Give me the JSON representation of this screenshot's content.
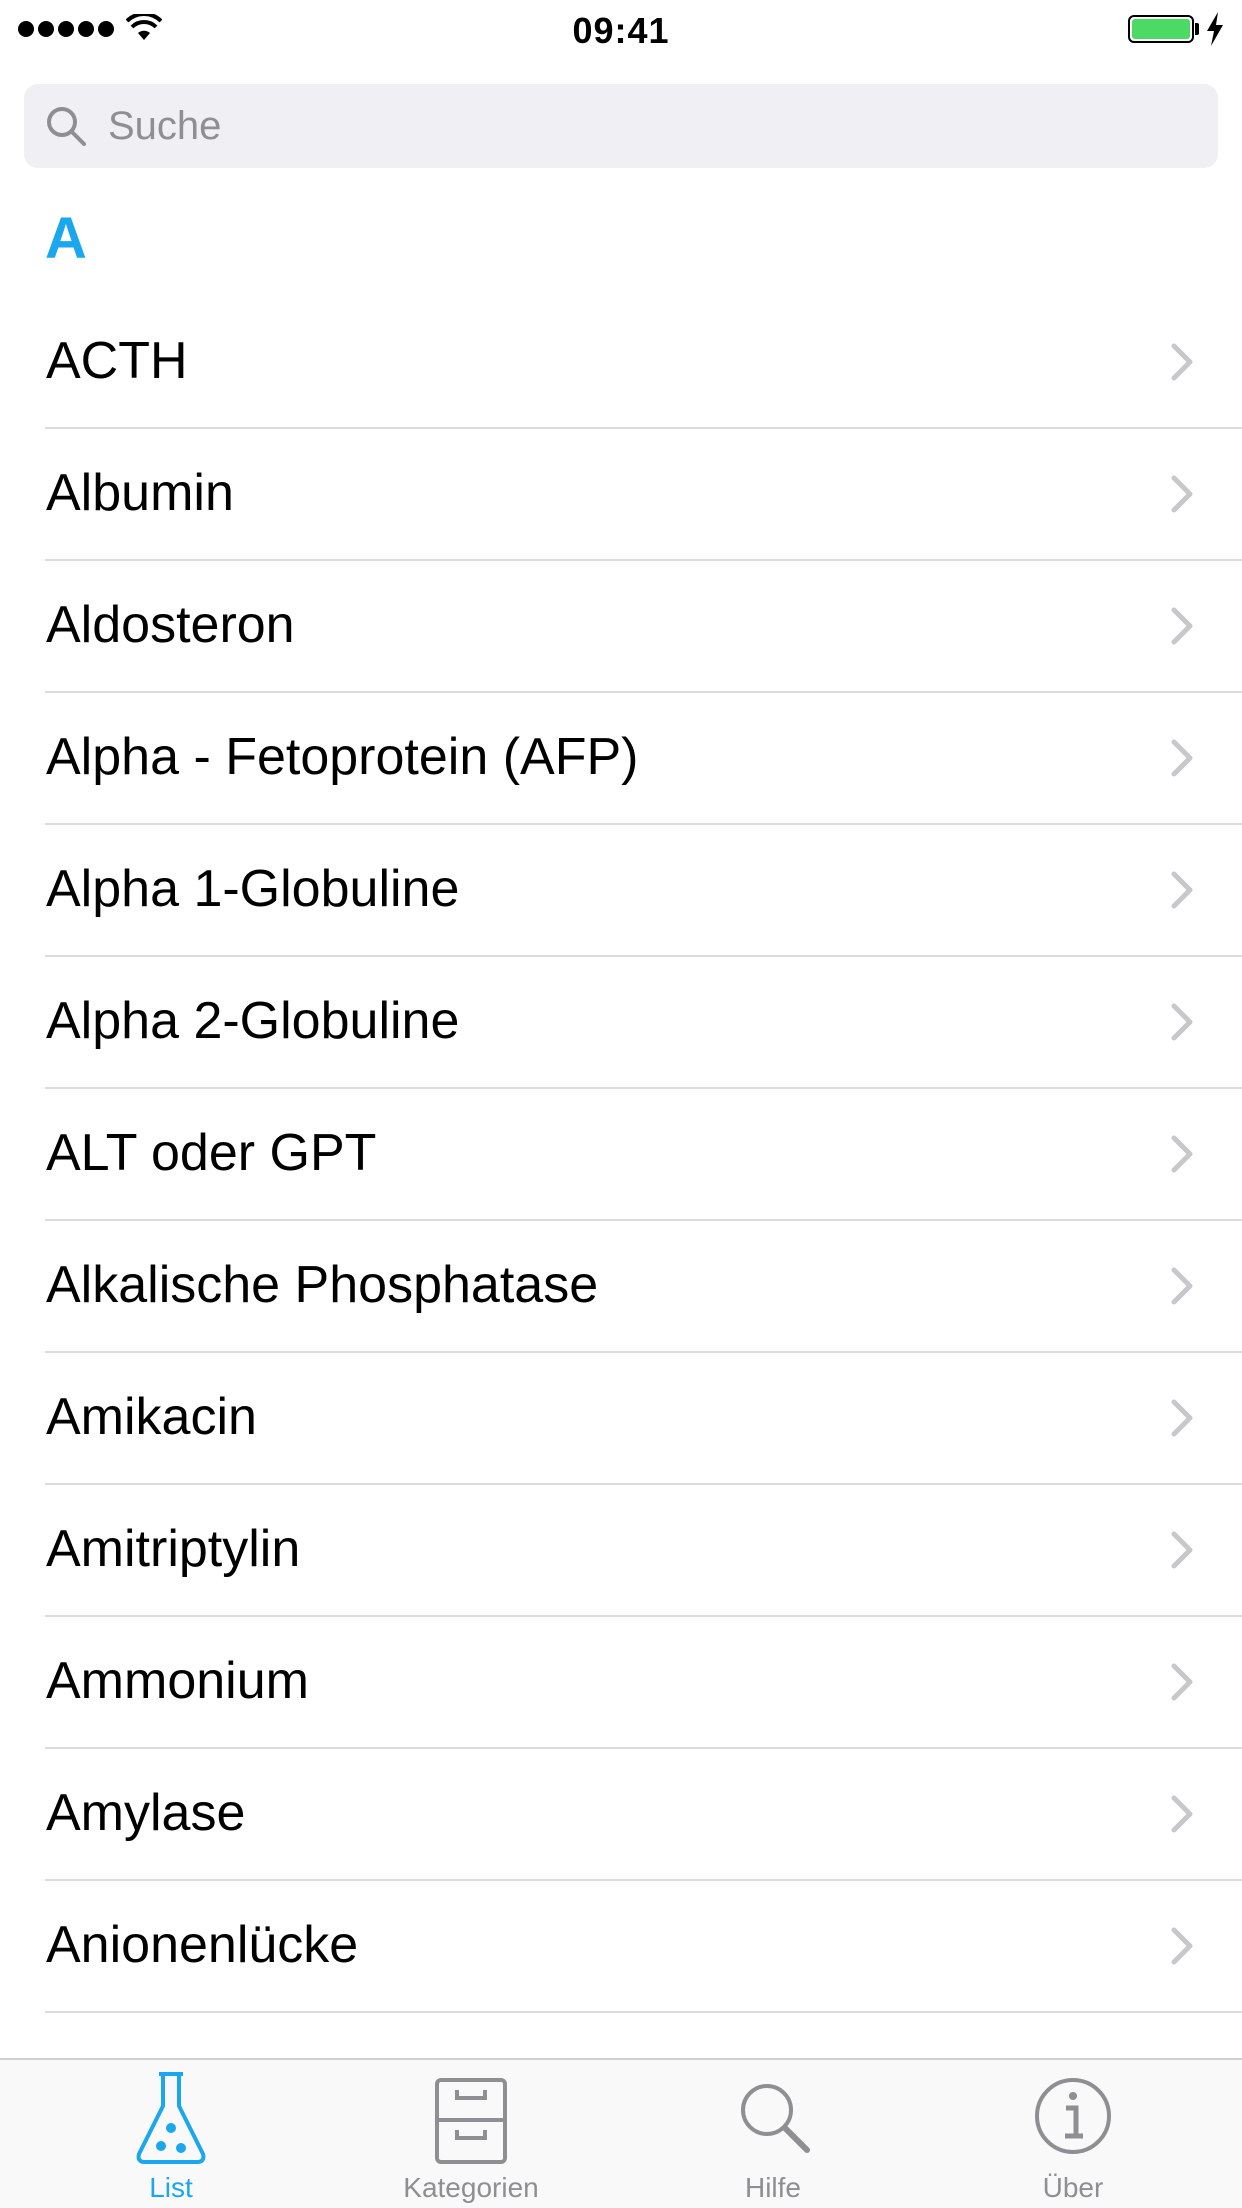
{
  "status_bar": {
    "time": "09:41",
    "battery_level": 1.0,
    "charging": true,
    "signal_bars": 5
  },
  "search": {
    "placeholder": "Suche",
    "value": ""
  },
  "section": {
    "header": "A"
  },
  "list": {
    "items": [
      {
        "label": "ACTH"
      },
      {
        "label": "Albumin"
      },
      {
        "label": "Aldosteron"
      },
      {
        "label": "Alpha - Fetoprotein (AFP)"
      },
      {
        "label": "Alpha 1-Globuline"
      },
      {
        "label": "Alpha 2-Globuline"
      },
      {
        "label": "ALT oder GPT"
      },
      {
        "label": "Alkalische Phosphatase"
      },
      {
        "label": "Amikacin"
      },
      {
        "label": "Amitriptylin"
      },
      {
        "label": "Ammonium"
      },
      {
        "label": "Amylase"
      },
      {
        "label": "Anionenlücke"
      }
    ]
  },
  "tab_bar": {
    "tabs": [
      {
        "label": "List",
        "icon": "flask-icon",
        "active": true
      },
      {
        "label": "Kategorien",
        "icon": "drawer-icon",
        "active": false
      },
      {
        "label": "Hilfe",
        "icon": "search-icon",
        "active": false
      },
      {
        "label": "Über",
        "icon": "info-icon",
        "active": false
      }
    ]
  },
  "colors": {
    "accent": "#1aa7f0",
    "inactive": "#8e8e93",
    "battery": "#4cd964"
  }
}
